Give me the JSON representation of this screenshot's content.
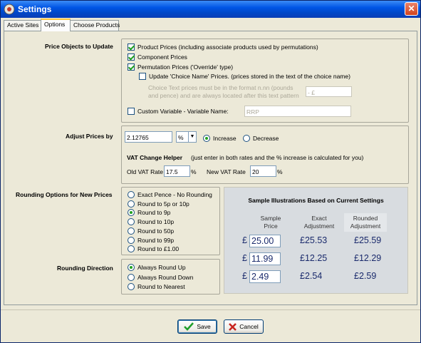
{
  "window": {
    "title": "Settings",
    "close_glyph": "✕"
  },
  "tabs": [
    {
      "label": "Active Sites"
    },
    {
      "label": "Options"
    },
    {
      "label": "Choose Products"
    }
  ],
  "price_objects": {
    "section_label": "Price Objects to Update",
    "product_prices": "Product Prices (including associate products used by permutations)",
    "component_prices": "Component Prices",
    "permutation_prices": "Permutation Prices ('Override' type)",
    "choice_name": "Update 'Choice Name' Prices. (prices stored in the text of the choice name)",
    "choice_note_line1": "Choice Text prices must be in the format n.nn (pounds",
    "choice_note_line2": "and pence) and are always located after this text pattern",
    "choice_pattern_value": "- £",
    "custom_variable": "Custom Variable - Variable Name:",
    "custom_variable_value": "RRP"
  },
  "adjust": {
    "section_label": "Adjust Prices by",
    "amount": "2.12765",
    "unit": "%",
    "increase": "Increase",
    "decrease": "Decrease",
    "vat_title": "VAT Change Helper",
    "vat_hint": "(just enter in both rates and the % increase is calculated for you)",
    "old_vat_label": "Old VAT Rate",
    "old_vat_value": "17.5",
    "new_vat_label": "New VAT Rate",
    "new_vat_value": "20",
    "pct": "%"
  },
  "rounding": {
    "section_label": "Rounding Options for New Prices",
    "options": [
      "Exact Pence - No Rounding",
      "Round to 5p or 10p",
      "Round to 9p",
      "Round to 10p",
      "Round to 50p",
      "Round to 99p",
      "Round to £1.00"
    ],
    "selected_index": 2
  },
  "direction": {
    "section_label": "Rounding Direction",
    "options": [
      "Always Round Up",
      "Always Round Down",
      "Round to Nearest"
    ],
    "selected_index": 0
  },
  "samples": {
    "title": "Sample Illustrations Based on Current Settings",
    "col_sample_1": "Sample",
    "col_sample_2": "Price",
    "col_exact_1": "Exact",
    "col_exact_2": "Adjustment",
    "col_rounded_1": "Rounded",
    "col_rounded_2": "Adjustment",
    "currency": "£",
    "rows": [
      {
        "sample": "25.00",
        "exact": "£25.53",
        "rounded": "£25.59"
      },
      {
        "sample": "11.99",
        "exact": "£12.25",
        "rounded": "£12.29"
      },
      {
        "sample": "2.49",
        "exact": "£2.54",
        "rounded": "£2.59"
      }
    ]
  },
  "buttons": {
    "save": "Save",
    "cancel": "Cancel"
  },
  "colors": {
    "title_bar": "#0055E5",
    "check": "#21A121",
    "close": "#D2431E"
  }
}
